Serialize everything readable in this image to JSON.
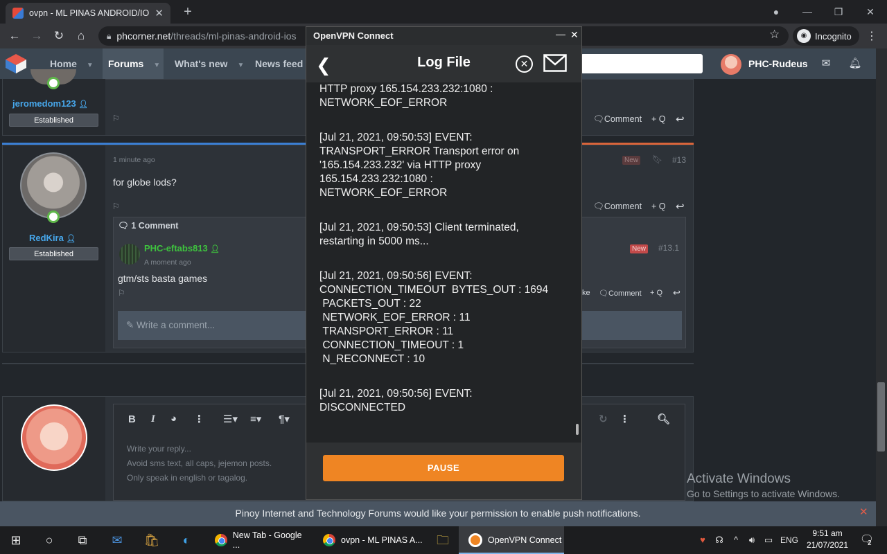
{
  "browser": {
    "tab_title": "ovpn - ML PINAS ANDROID/IOS",
    "url_host": "phcorner.net",
    "url_path": "/threads/ml-pinas-android-ios",
    "incognito_label": "Incognito"
  },
  "site": {
    "nav": [
      "Home",
      "Forums",
      "What's new",
      "News feed"
    ],
    "active_nav": "Forums",
    "username": "PHC-Rudeus"
  },
  "posts": {
    "p1": {
      "user": "jeromedom123",
      "badge": "Established",
      "comment_label": "Comment",
      "quote_label": "+ Q"
    },
    "p2": {
      "user": "RedKira",
      "badge": "Established",
      "time": "1 minute ago",
      "text": "for globe lods?",
      "new_label": "New",
      "post_no": "#13",
      "comment_label": "Comment",
      "quote_label": "+ Q",
      "comments_header": "1 Comment",
      "reply": {
        "user": "PHC-eftabs813",
        "time": "A moment ago",
        "text": "gtm/sts basta games",
        "new_label": "New",
        "post_no": "#13.1",
        "like_fragment": "ke",
        "comment_label": "Comment",
        "quote_label": "+ Q"
      },
      "write_comment": "Write a comment..."
    },
    "editor": {
      "placeholder_line1": "Write your reply...",
      "placeholder_line2": "Avoid sms text, all caps, jejemon posts.",
      "placeholder_line3": "Only speak in english or tagalog."
    }
  },
  "vpn": {
    "window_title": "OpenVPN Connect",
    "header_title": "Log File",
    "log": [
      "HTTP proxy 165.154.233.232:1080 :\nNETWORK_EOF_ERROR",
      "[Jul 21, 2021, 09:50:53] EVENT:\nTRANSPORT_ERROR Transport error on\n'165.154.233.232' via HTTP proxy\n165.154.233.232:1080 :\nNETWORK_EOF_ERROR",
      "[Jul 21, 2021, 09:50:53] Client terminated,\nrestarting in 5000 ms...",
      "[Jul 21, 2021, 09:50:56] EVENT:\nCONNECTION_TIMEOUT  BYTES_OUT : 1694\n PACKETS_OUT : 22\n NETWORK_EOF_ERROR : 11\n TRANSPORT_ERROR : 11\n CONNECTION_TIMEOUT : 1\n N_RECONNECT : 10",
      "[Jul 21, 2021, 09:50:56] EVENT:\nDISCONNECTED"
    ],
    "pause_label": "PAUSE"
  },
  "activate_windows": {
    "line1": "Activate Windows",
    "line2": "Go to Settings to activate Windows."
  },
  "notification": "Pinoy Internet and Technology Forums would like your permission to enable push notifications.",
  "taskbar": {
    "apps": [
      "New Tab - Google ...",
      "ovpn - ML PINAS A...",
      "OpenVPN Connect"
    ],
    "lang": "ENG",
    "time": "9:51 am",
    "date": "21/07/2021",
    "notif_count": "2"
  },
  "colors": {
    "accent_orange": "#ef8523",
    "username_blue": "#47a7eb",
    "green_user": "#3ec33e"
  }
}
